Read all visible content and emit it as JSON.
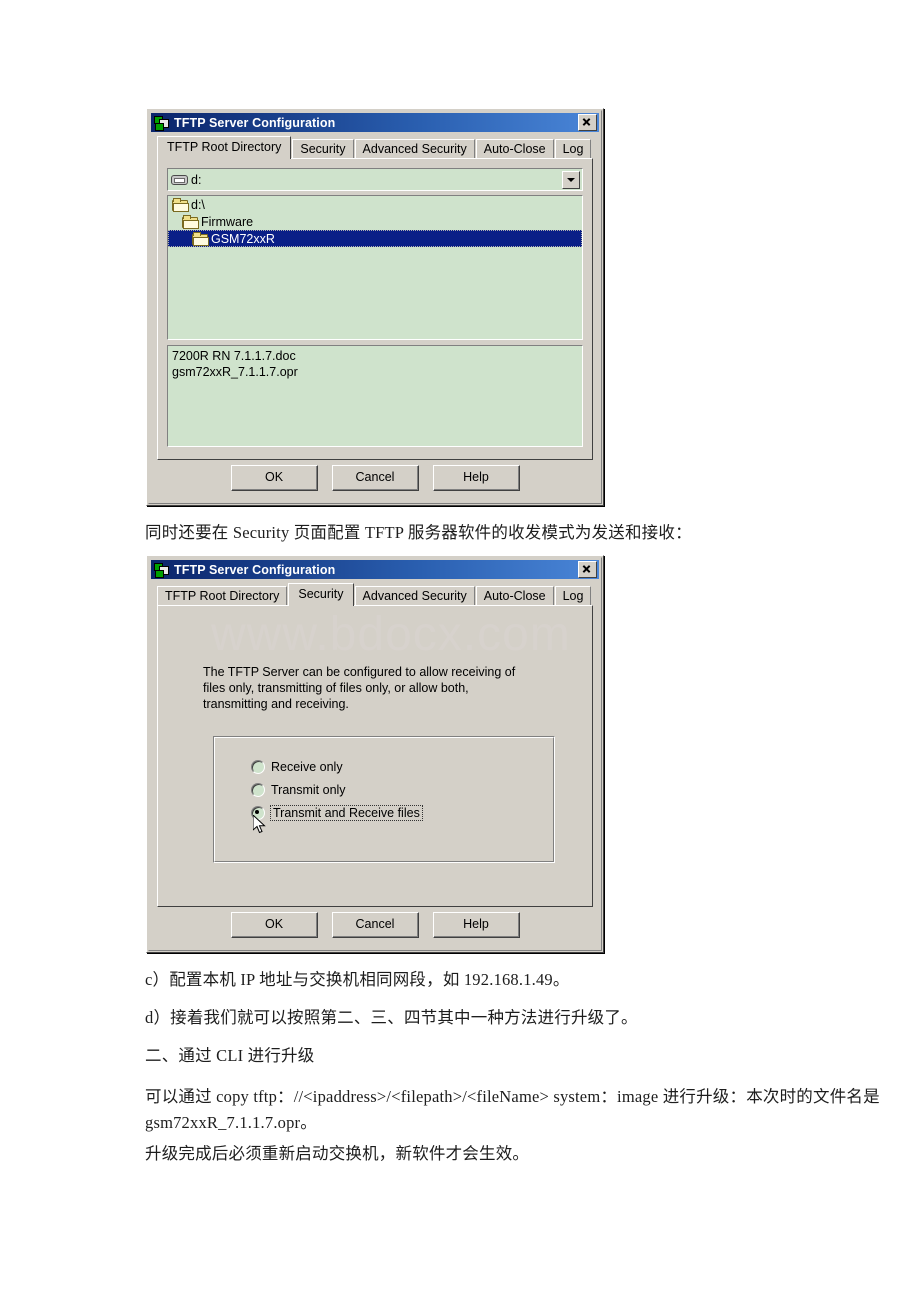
{
  "document": {
    "caption_security": "同时还要在 Security 页面配置 TFTP 服务器软件的收发模式为发送和接收：",
    "para_c": "c）配置本机 IP 地址与交换机相同网段，如 192.168.1.49。",
    "para_d": "d）接着我们就可以按照第二、三、四节其中一种方法进行升级了。",
    "heading_two": "二、通过 CLI 进行升级",
    "para_cli": "可以通过 copy tftp：//<ipaddress>/<filepath>/<fileName> system：image 进行升级：本次时的文件名是 gsm72xxR_7.1.1.7.opr。",
    "para_last": "升级完成后必须重新启动交换机，新软件才会生效。",
    "watermark": "www.bdocx.com"
  },
  "dialog1": {
    "title": "TFTP Server Configuration",
    "title_icon": "network-app-icon",
    "close_icon": "close-icon",
    "tabs": [
      {
        "label": "TFTP Root Directory",
        "active": true
      },
      {
        "label": "Security",
        "active": false
      },
      {
        "label": "Advanced Security",
        "active": false
      },
      {
        "label": "Auto-Close",
        "active": false
      },
      {
        "label": "Log",
        "active": false
      }
    ],
    "drive_combo": {
      "value": "d:",
      "icon": "drive-icon",
      "arrow_icon": "chevron-down-icon"
    },
    "tree": [
      {
        "label": "d:\\",
        "level": 0,
        "selected": false
      },
      {
        "label": "Firmware",
        "level": 1,
        "selected": false
      },
      {
        "label": "GSM72xxR",
        "level": 2,
        "selected": true
      }
    ],
    "files": [
      "7200R RN 7.1.1.7.doc",
      "gsm72xxR_7.1.1.7.opr"
    ],
    "buttons": {
      "ok": "OK",
      "cancel": "Cancel",
      "help": "Help"
    }
  },
  "dialog2": {
    "title": "TFTP Server Configuration",
    "title_icon": "network-app-icon",
    "close_icon": "close-icon",
    "tabs": [
      {
        "label": "TFTP Root Directory",
        "active": false
      },
      {
        "label": "Security",
        "active": true
      },
      {
        "label": "Advanced Security",
        "active": false
      },
      {
        "label": "Auto-Close",
        "active": false
      },
      {
        "label": "Log",
        "active": false
      }
    ],
    "description": "The TFTP Server can be configured to allow receiving of files only, transmitting of files only, or allow both, transmitting and receiving.",
    "radios": [
      {
        "label": "Receive only",
        "selected": false
      },
      {
        "label": "Transmit only",
        "selected": false
      },
      {
        "label": "Transmit and Receive files",
        "selected": true
      }
    ],
    "buttons": {
      "ok": "OK",
      "cancel": "Cancel",
      "help": "Help"
    }
  }
}
